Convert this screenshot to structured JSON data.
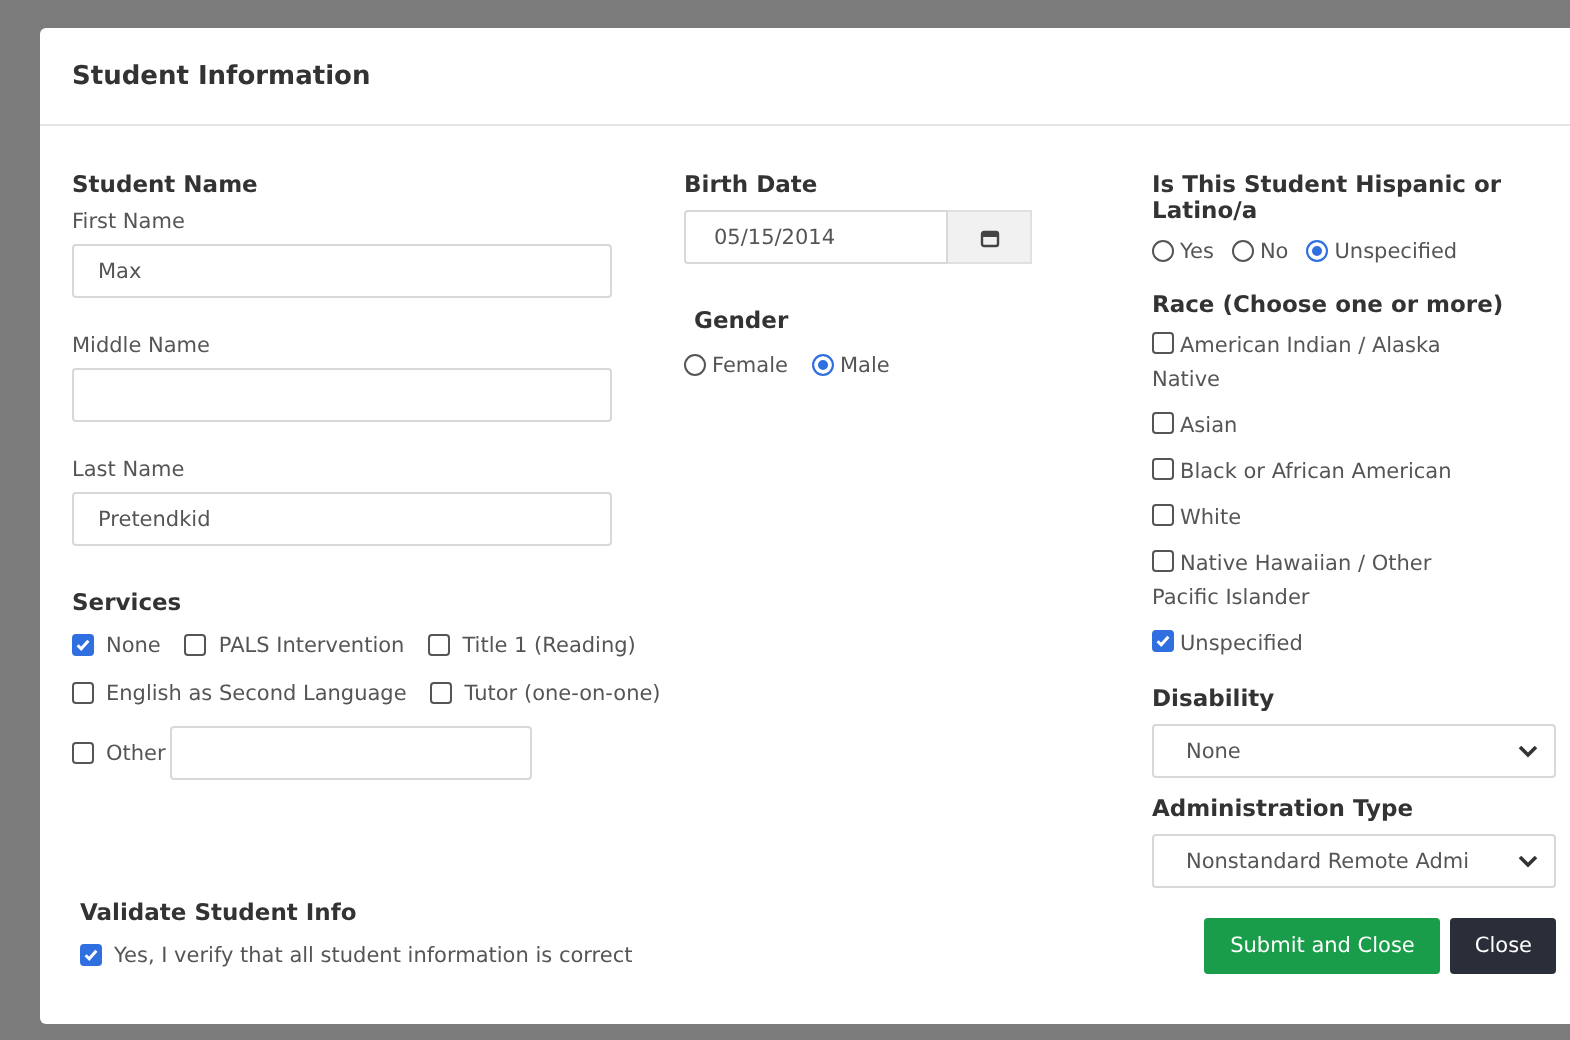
{
  "dialog": {
    "title": "Student Information"
  },
  "student_name": {
    "heading": "Student Name",
    "fields": [
      {
        "label": "First Name",
        "value": "Max"
      },
      {
        "label": "Middle Name"
      },
      {
        "label": "Last Name",
        "value": "Pretendkid"
      }
    ]
  },
  "birth_date": {
    "label": "Birth Date",
    "value": "05/15/2014"
  },
  "gender": {
    "label": "Gender",
    "options": [
      {
        "label": "Female",
        "selected": false
      },
      {
        "label": "Male",
        "selected": true
      }
    ]
  },
  "services": {
    "label": "Services",
    "options": [
      {
        "kind": "checkbox",
        "label": "None",
        "checked": true
      },
      {
        "kind": "checkbox",
        "label": "PALS Intervention",
        "checked": false
      },
      {
        "kind": "checkbox",
        "label": "Title 1 (Reading)",
        "checked": false
      },
      {
        "kind": "checkbox",
        "label": "English as Second Language",
        "checked": false
      },
      {
        "kind": "checkbox",
        "label": "Tutor (one-on-one)",
        "checked": false
      },
      {
        "kind": "checkbox_with_field",
        "label": "Other",
        "checked": false
      }
    ]
  },
  "hispanic": {
    "label": "Is This Student Hispanic or Latino/a",
    "options": [
      {
        "label": "Yes",
        "selected": false
      },
      {
        "label": "No",
        "selected": false
      },
      {
        "label": "Unspecified",
        "selected": true
      }
    ]
  },
  "race": {
    "label": "Race (Choose one or more)",
    "options": [
      {
        "label": "American Indian / Alaska Native",
        "checked": false
      },
      {
        "label": "Asian",
        "checked": false
      },
      {
        "label": "Black or African American",
        "checked": false
      },
      {
        "label": "White",
        "checked": false
      },
      {
        "label": "Native Hawaiian / Other Pacific Islander",
        "checked": false
      },
      {
        "label": "Unspecified",
        "checked": true
      }
    ]
  },
  "disability": {
    "label": "Disability",
    "value": "None"
  },
  "administration_type": {
    "label": "Administration Type",
    "value": "Nonstandard Remote Admi"
  },
  "validate": {
    "heading": "Validate Student Info",
    "label": "Yes, I verify that all student information is correct",
    "checked": true
  },
  "buttons": [
    {
      "label": "Submit and Close",
      "kind": "primary"
    },
    {
      "label": "Close",
      "kind": "secondary"
    }
  ]
}
